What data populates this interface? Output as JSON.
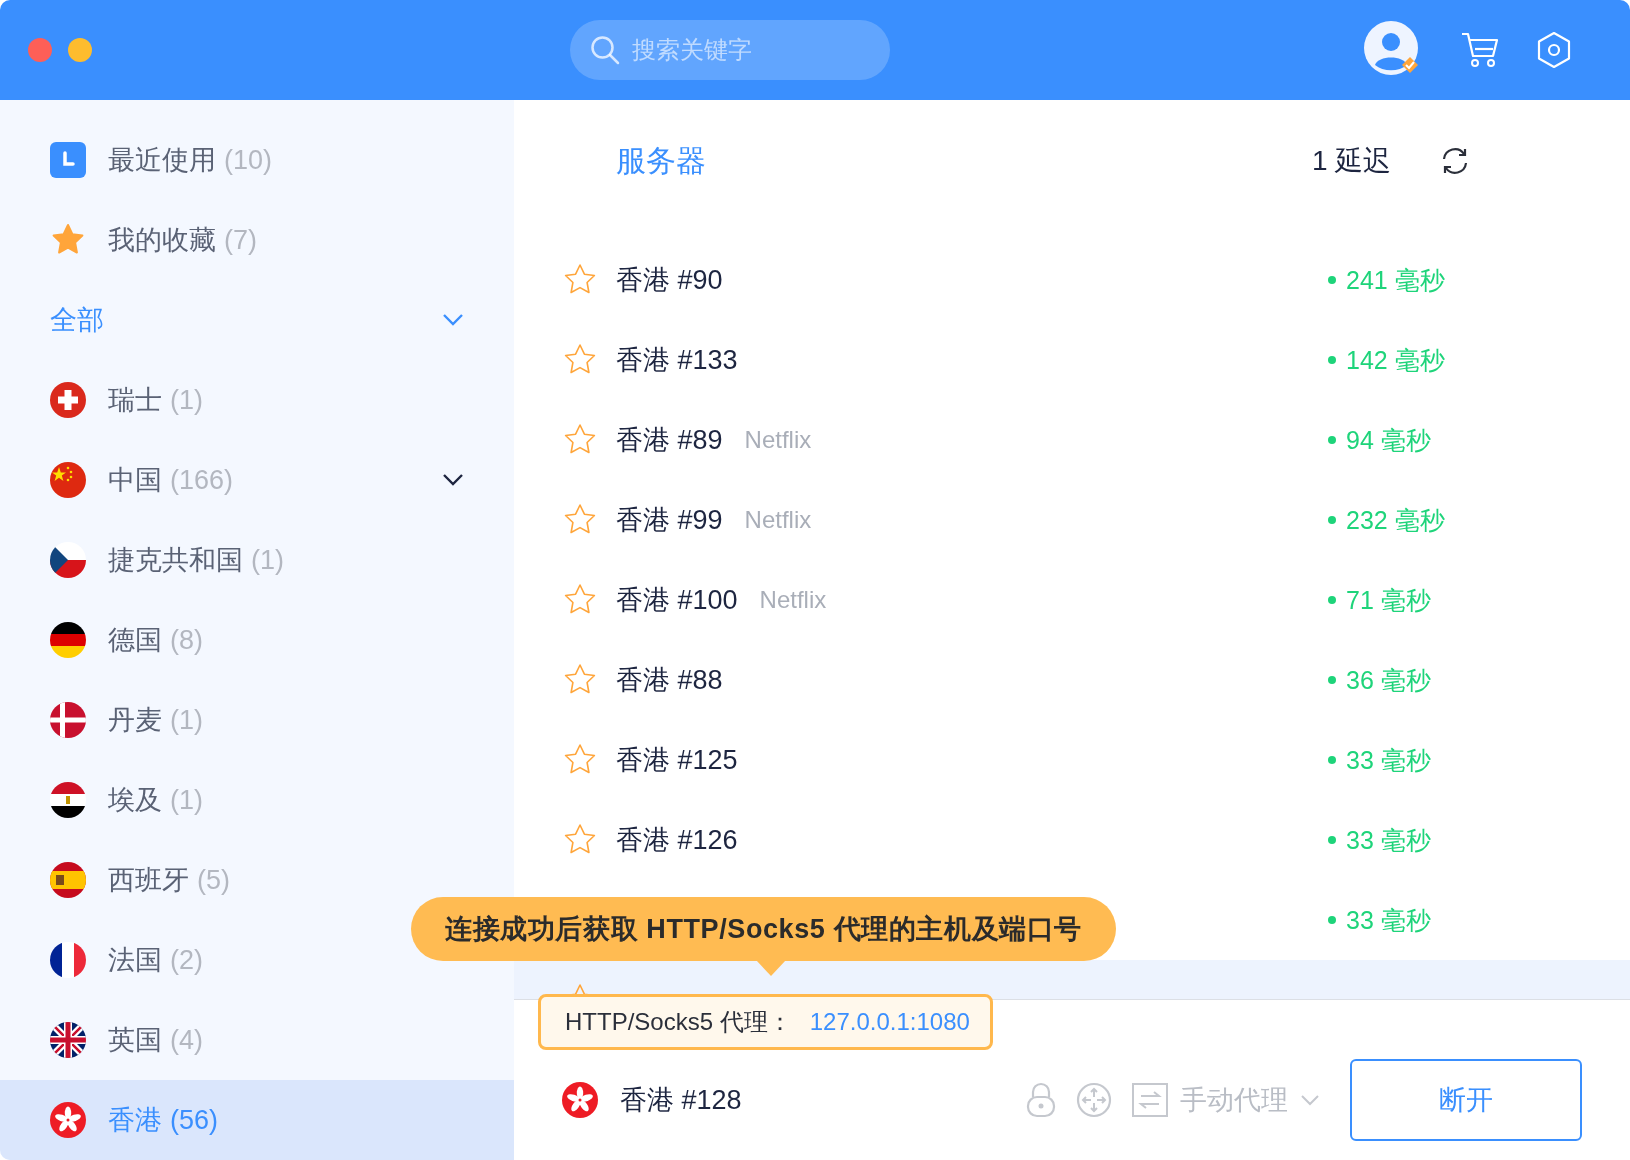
{
  "search": {
    "placeholder": "搜索关键字"
  },
  "sidebar": {
    "items": [
      {
        "kind": "recent",
        "label": "最近使用",
        "count": "(10)",
        "selected": false
      },
      {
        "kind": "favorites",
        "label": "我的收藏",
        "count": "(7)",
        "selected": false
      },
      {
        "kind": "group",
        "label": "全部",
        "expandable": true,
        "selected": false
      },
      {
        "kind": "country",
        "label": "瑞士",
        "count": "(1)",
        "selected": false
      },
      {
        "kind": "country",
        "label": "中国",
        "count": "(166)",
        "expandable": true,
        "selected": false
      },
      {
        "kind": "country",
        "label": "捷克共和国",
        "count": "(1)",
        "selected": false
      },
      {
        "kind": "country",
        "label": "德国",
        "count": "(8)",
        "selected": false
      },
      {
        "kind": "country",
        "label": "丹麦",
        "count": "(1)",
        "selected": false
      },
      {
        "kind": "country",
        "label": "埃及",
        "count": "(1)",
        "selected": false
      },
      {
        "kind": "country",
        "label": "西班牙",
        "count": "(5)",
        "selected": false
      },
      {
        "kind": "country",
        "label": "法国",
        "count": "(2)",
        "selected": false
      },
      {
        "kind": "country",
        "label": "英国",
        "count": "(4)",
        "selected": false
      },
      {
        "kind": "country",
        "label": "香港",
        "count": "(56)",
        "selected": true
      }
    ]
  },
  "server_list": {
    "title": "服务器",
    "sort_label": "1 延迟",
    "rows": [
      {
        "name": "香港 #90",
        "latency": "241 毫秒",
        "favorite": false,
        "selected": false
      },
      {
        "name": "香港 #133",
        "latency": "142 毫秒",
        "favorite": false,
        "selected": false
      },
      {
        "name": "香港 #89",
        "tag": "Netflix",
        "latency": "94 毫秒",
        "favorite": false,
        "selected": false
      },
      {
        "name": "香港 #99",
        "tag": "Netflix",
        "latency": "232 毫秒",
        "favorite": false,
        "selected": false
      },
      {
        "name": "香港 #100",
        "tag": "Netflix",
        "latency": "71 毫秒",
        "favorite": false,
        "selected": false
      },
      {
        "name": "香港 #88",
        "latency": "36 毫秒",
        "favorite": false,
        "selected": false
      },
      {
        "name": "香港 #125",
        "latency": "33 毫秒",
        "favorite": false,
        "selected": false
      },
      {
        "name": "香港 #126",
        "latency": "33 毫秒",
        "favorite": false,
        "selected": false
      },
      {
        "latency": "33 毫秒",
        "selected": false
      },
      {
        "favorite": false,
        "selected": true
      }
    ]
  },
  "tooltip": "连接成功后获取 HTTP/Socks5 代理的主机及端口号",
  "proxy_info": {
    "label": "HTTP/Socks5 代理：",
    "address": "127.0.0.1:1080"
  },
  "connection": {
    "server": "香港 #128",
    "mode": "手动代理",
    "button": "断开"
  }
}
